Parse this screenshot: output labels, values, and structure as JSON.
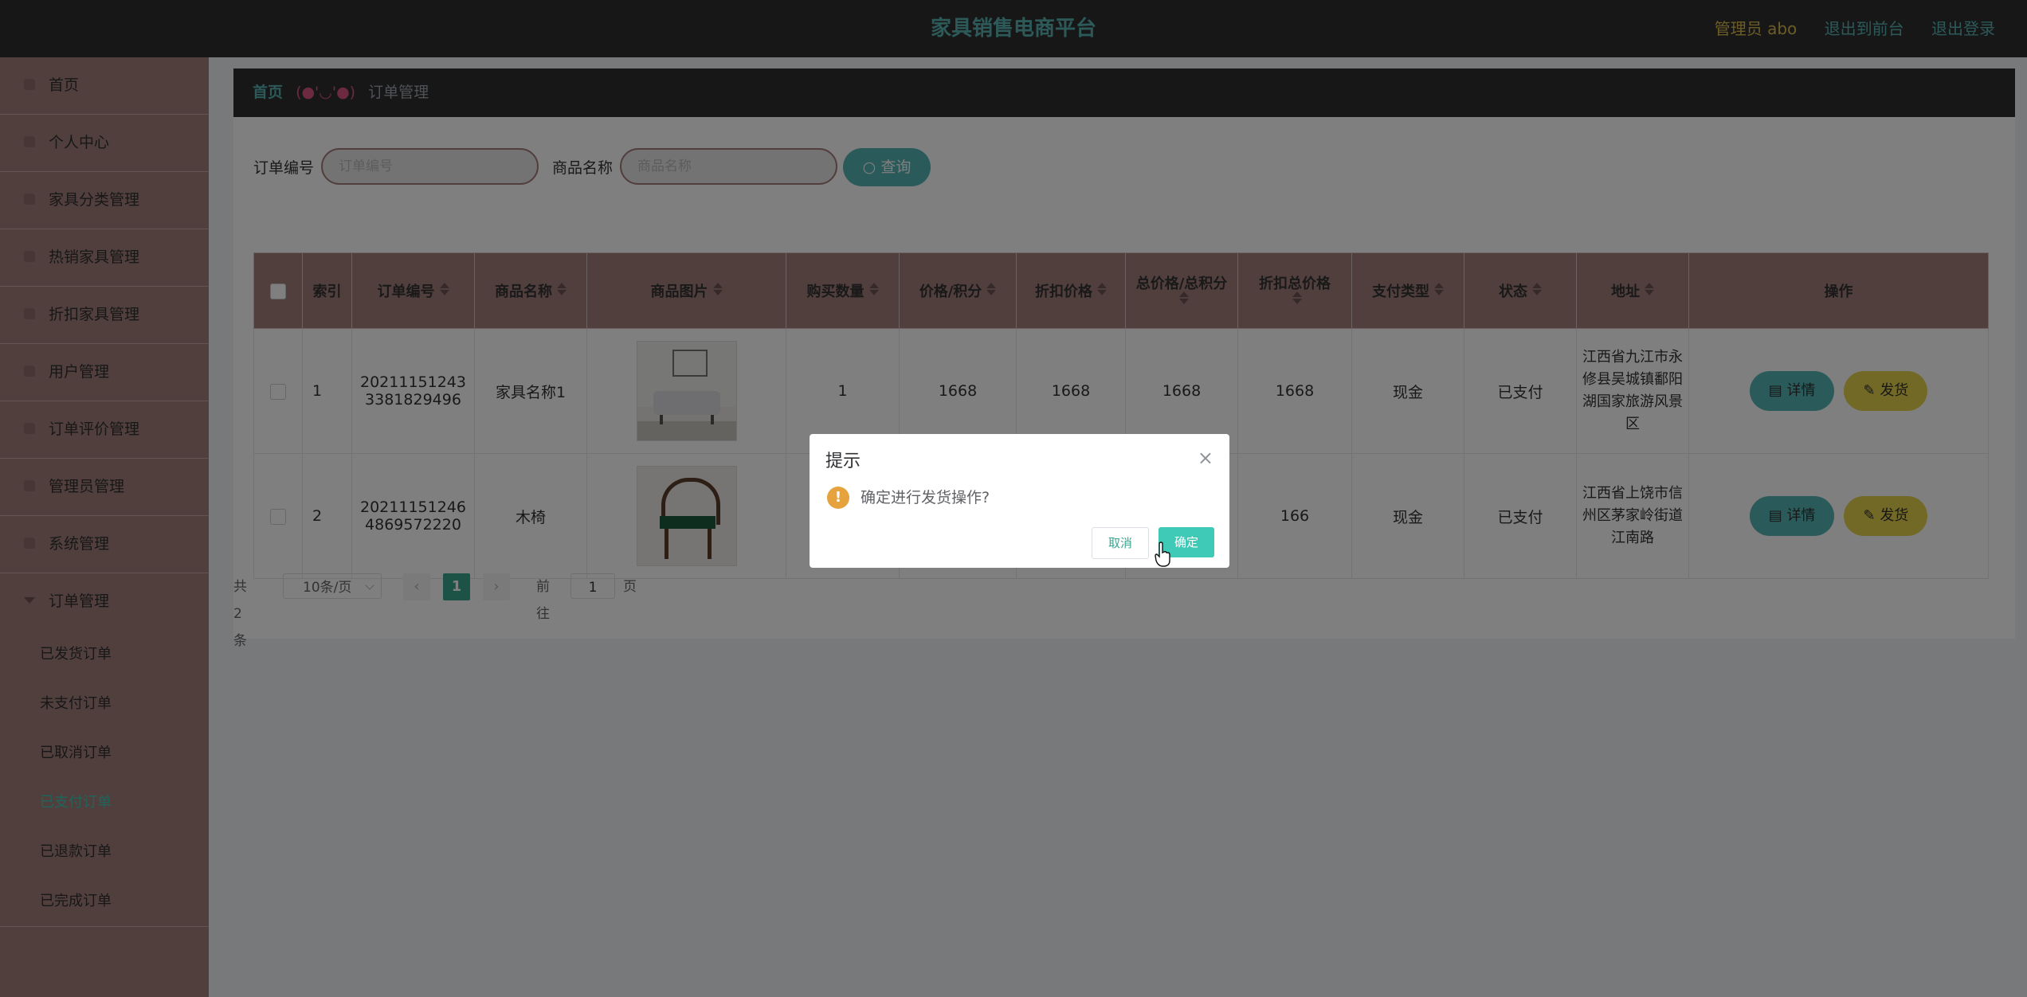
{
  "header": {
    "title": "家具销售电商平台",
    "admin_label": "管理员 abo",
    "front_link": "退出到前台",
    "logout_link": "退出登录"
  },
  "sidebar": {
    "items": [
      {
        "label": "首页",
        "icon": "home-icon"
      },
      {
        "label": "个人中心",
        "icon": "user-icon"
      },
      {
        "label": "家具分类管理",
        "icon": "category-icon"
      },
      {
        "label": "热销家具管理",
        "icon": "fire-icon"
      },
      {
        "label": "折扣家具管理",
        "icon": "discount-icon"
      },
      {
        "label": "用户管理",
        "icon": "users-icon"
      },
      {
        "label": "订单评价管理",
        "icon": "comment-icon"
      },
      {
        "label": "管理员管理",
        "icon": "admin-icon"
      },
      {
        "label": "系统管理",
        "icon": "gear-icon"
      },
      {
        "label": "订单管理",
        "icon": "chevron-down-icon"
      }
    ],
    "sub_items": [
      "已发货订单",
      "未支付订单",
      "已取消订单",
      "已支付订单",
      "已退款订单",
      "已完成订单"
    ],
    "active_sub": "已支付订单"
  },
  "breadcrumb": {
    "home": "首页",
    "separator": "(●'◡'●)",
    "current": "订单管理"
  },
  "search": {
    "order_no_label": "订单编号",
    "order_no_placeholder": "订单编号",
    "order_no_value": "",
    "product_label": "商品名称",
    "product_placeholder": "商品名称",
    "product_value": "",
    "query_button": "查询"
  },
  "table": {
    "columns": [
      "索引",
      "订单编号",
      "商品名称",
      "商品图片",
      "购买数量",
      "价格/积分",
      "折扣价格",
      "总价格/总积分",
      "折扣总价格",
      "支付类型",
      "状态",
      "地址",
      "操作"
    ],
    "rows": [
      {
        "index": "1",
        "order_no": "202111512433381829496",
        "product": "家具名称1",
        "image": "sofa",
        "qty": "1",
        "price": "1668",
        "discount_price": "1668",
        "total": "1668",
        "discount_total": "1668",
        "pay_type": "现金",
        "status": "已支付",
        "address": "江西省九江市永修县吴城镇鄱阳湖国家旅游风景区",
        "detail_button": "详情",
        "ship_button": "发货"
      },
      {
        "index": "2",
        "order_no": "202111512464869572220",
        "product": "木椅",
        "image": "chair",
        "qty": "",
        "price": "",
        "discount_price": "",
        "total": "",
        "discount_total": "166",
        "pay_type": "现金",
        "status": "已支付",
        "address": "江西省上饶市信州区茅家岭街道江南路",
        "detail_button": "详情",
        "ship_button": "发货"
      }
    ]
  },
  "pagination": {
    "total_text": "共 2 条",
    "page_size": "10条/页",
    "current_page": "1",
    "goto_prefix": "前往",
    "goto_value": "1",
    "goto_suffix": "页"
  },
  "dialog": {
    "title": "提示",
    "message": "确定进行发货操作?",
    "cancel": "取消",
    "confirm": "确定"
  },
  "colors": {
    "accent": "#3fc9b7",
    "sidebar": "#a37f7c",
    "header": "#2f2f2f",
    "teal": "#55b5b5",
    "yellow": "#e6d34e"
  }
}
